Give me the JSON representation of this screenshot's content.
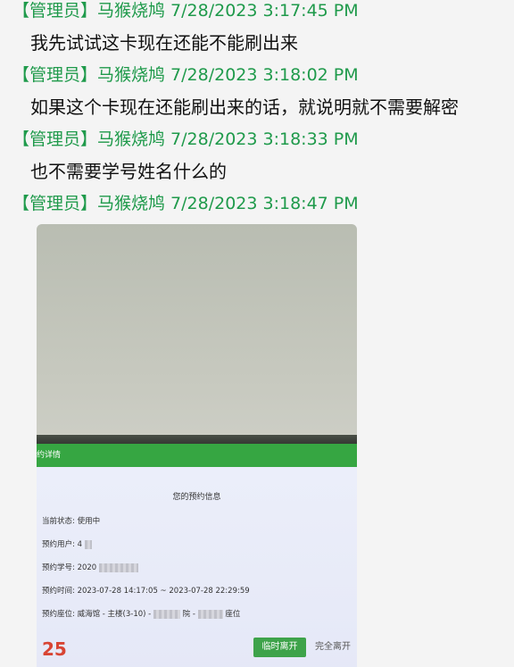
{
  "messages": [
    {
      "header": "【管理员】马猴烧鸠 7/28/2023 3:17:45 PM",
      "text": "我先试试这卡现在还能不能刷出来"
    },
    {
      "header": "【管理员】马猴烧鸠 7/28/2023 3:18:02 PM",
      "text": "如果这个卡现在还能刷出来的话，就说明就不需要解密"
    },
    {
      "header": "【管理员】马猴烧鸠 7/28/2023 3:18:33 PM",
      "text": "也不需要学号姓名什么的"
    },
    {
      "header": "【管理员】马猴烧鸠 7/28/2023 3:18:47 PM",
      "text": ""
    }
  ],
  "photo": {
    "screen_title": "约详情",
    "info_title": "您的预约信息",
    "status_label": "当前状态:",
    "status_value": "使用中",
    "user_label": "预约用户:",
    "user_value": "4",
    "student_id_label": "预约学号:",
    "student_id_value": "2020",
    "time_label": "预约时间:",
    "time_value": "2023-07-28 14:17:05 ~ 2023-07-28 22:29:59",
    "seat_label": "预约座位:",
    "seat_value_prefix": "威海馆 - 主楼(3-10) -",
    "seat_value_mid": "院 -",
    "seat_value_suffix": "座位",
    "countdown": "25",
    "leave_button": "临时离开",
    "full_leave_button": "完全离开"
  },
  "colors": {
    "header_green": "#1f9a4b",
    "screen_green": "#36a642",
    "countdown_red": "#d84433"
  }
}
